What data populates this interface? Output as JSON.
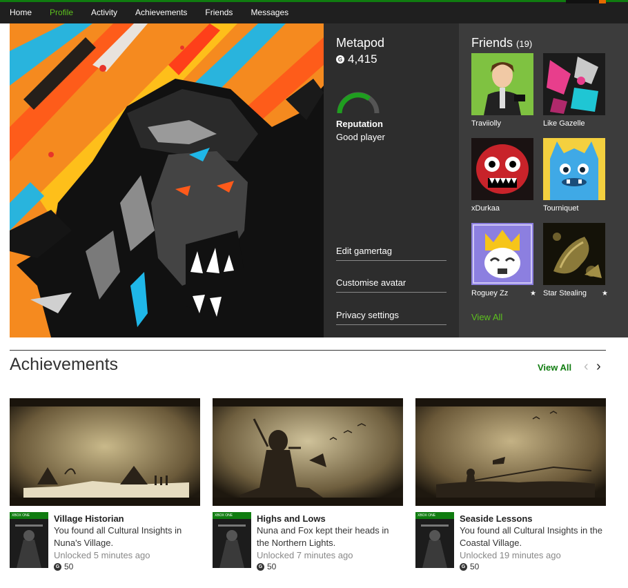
{
  "nav": {
    "items": [
      {
        "label": "Home",
        "active": false
      },
      {
        "label": "Profile",
        "active": true
      },
      {
        "label": "Activity",
        "active": false
      },
      {
        "label": "Achievements",
        "active": false
      },
      {
        "label": "Friends",
        "active": false
      },
      {
        "label": "Messages",
        "active": false
      }
    ]
  },
  "profile": {
    "gamertag": "Metapod",
    "gamerscore": "4,415",
    "reputation_label": "Reputation",
    "reputation_value": "Good player",
    "links": [
      "Edit gamertag",
      "Customise avatar",
      "Privacy settings"
    ]
  },
  "friends": {
    "title": "Friends",
    "count": "(19)",
    "view_all": "View All",
    "list": [
      {
        "name": "Traviiolly",
        "favorite": false
      },
      {
        "name": "Like Gazelle",
        "favorite": false
      },
      {
        "name": "xDurkaa",
        "favorite": false
      },
      {
        "name": "Tourniquet",
        "favorite": false
      },
      {
        "name": "Roguey Zz",
        "favorite": true
      },
      {
        "name": "Star Stealing",
        "favorite": true
      }
    ],
    "star_glyph": "★"
  },
  "achievements": {
    "title": "Achievements",
    "view_all": "View All",
    "prev_glyph": "‹",
    "next_glyph": "›",
    "platform_tag": "XBOX ONE",
    "items": [
      {
        "name": "Village Historian",
        "description": "You found all Cultural Insights in Nuna's Village.",
        "unlocked": "Unlocked 5 minutes ago",
        "points": "50"
      },
      {
        "name": "Highs and Lows",
        "description": "Nuna and Fox kept their heads in the Northern Lights.",
        "unlocked": "Unlocked 7 minutes ago",
        "points": "50"
      },
      {
        "name": "Seaside Lessons",
        "description": "You found all Cultural Insights in the Coastal Village.",
        "unlocked": "Unlocked 19 minutes ago",
        "points": "50"
      }
    ]
  },
  "colors": {
    "accent_green": "#107c10",
    "light_green": "#5dc21e",
    "nav_bg": "#1f1f1f",
    "panel_dark": "#2d2d2d",
    "panel_mid": "#3c3c3c"
  },
  "icons": {
    "gamerscore": "gamerscore-icon",
    "reputation": "reputation-gauge-icon"
  }
}
